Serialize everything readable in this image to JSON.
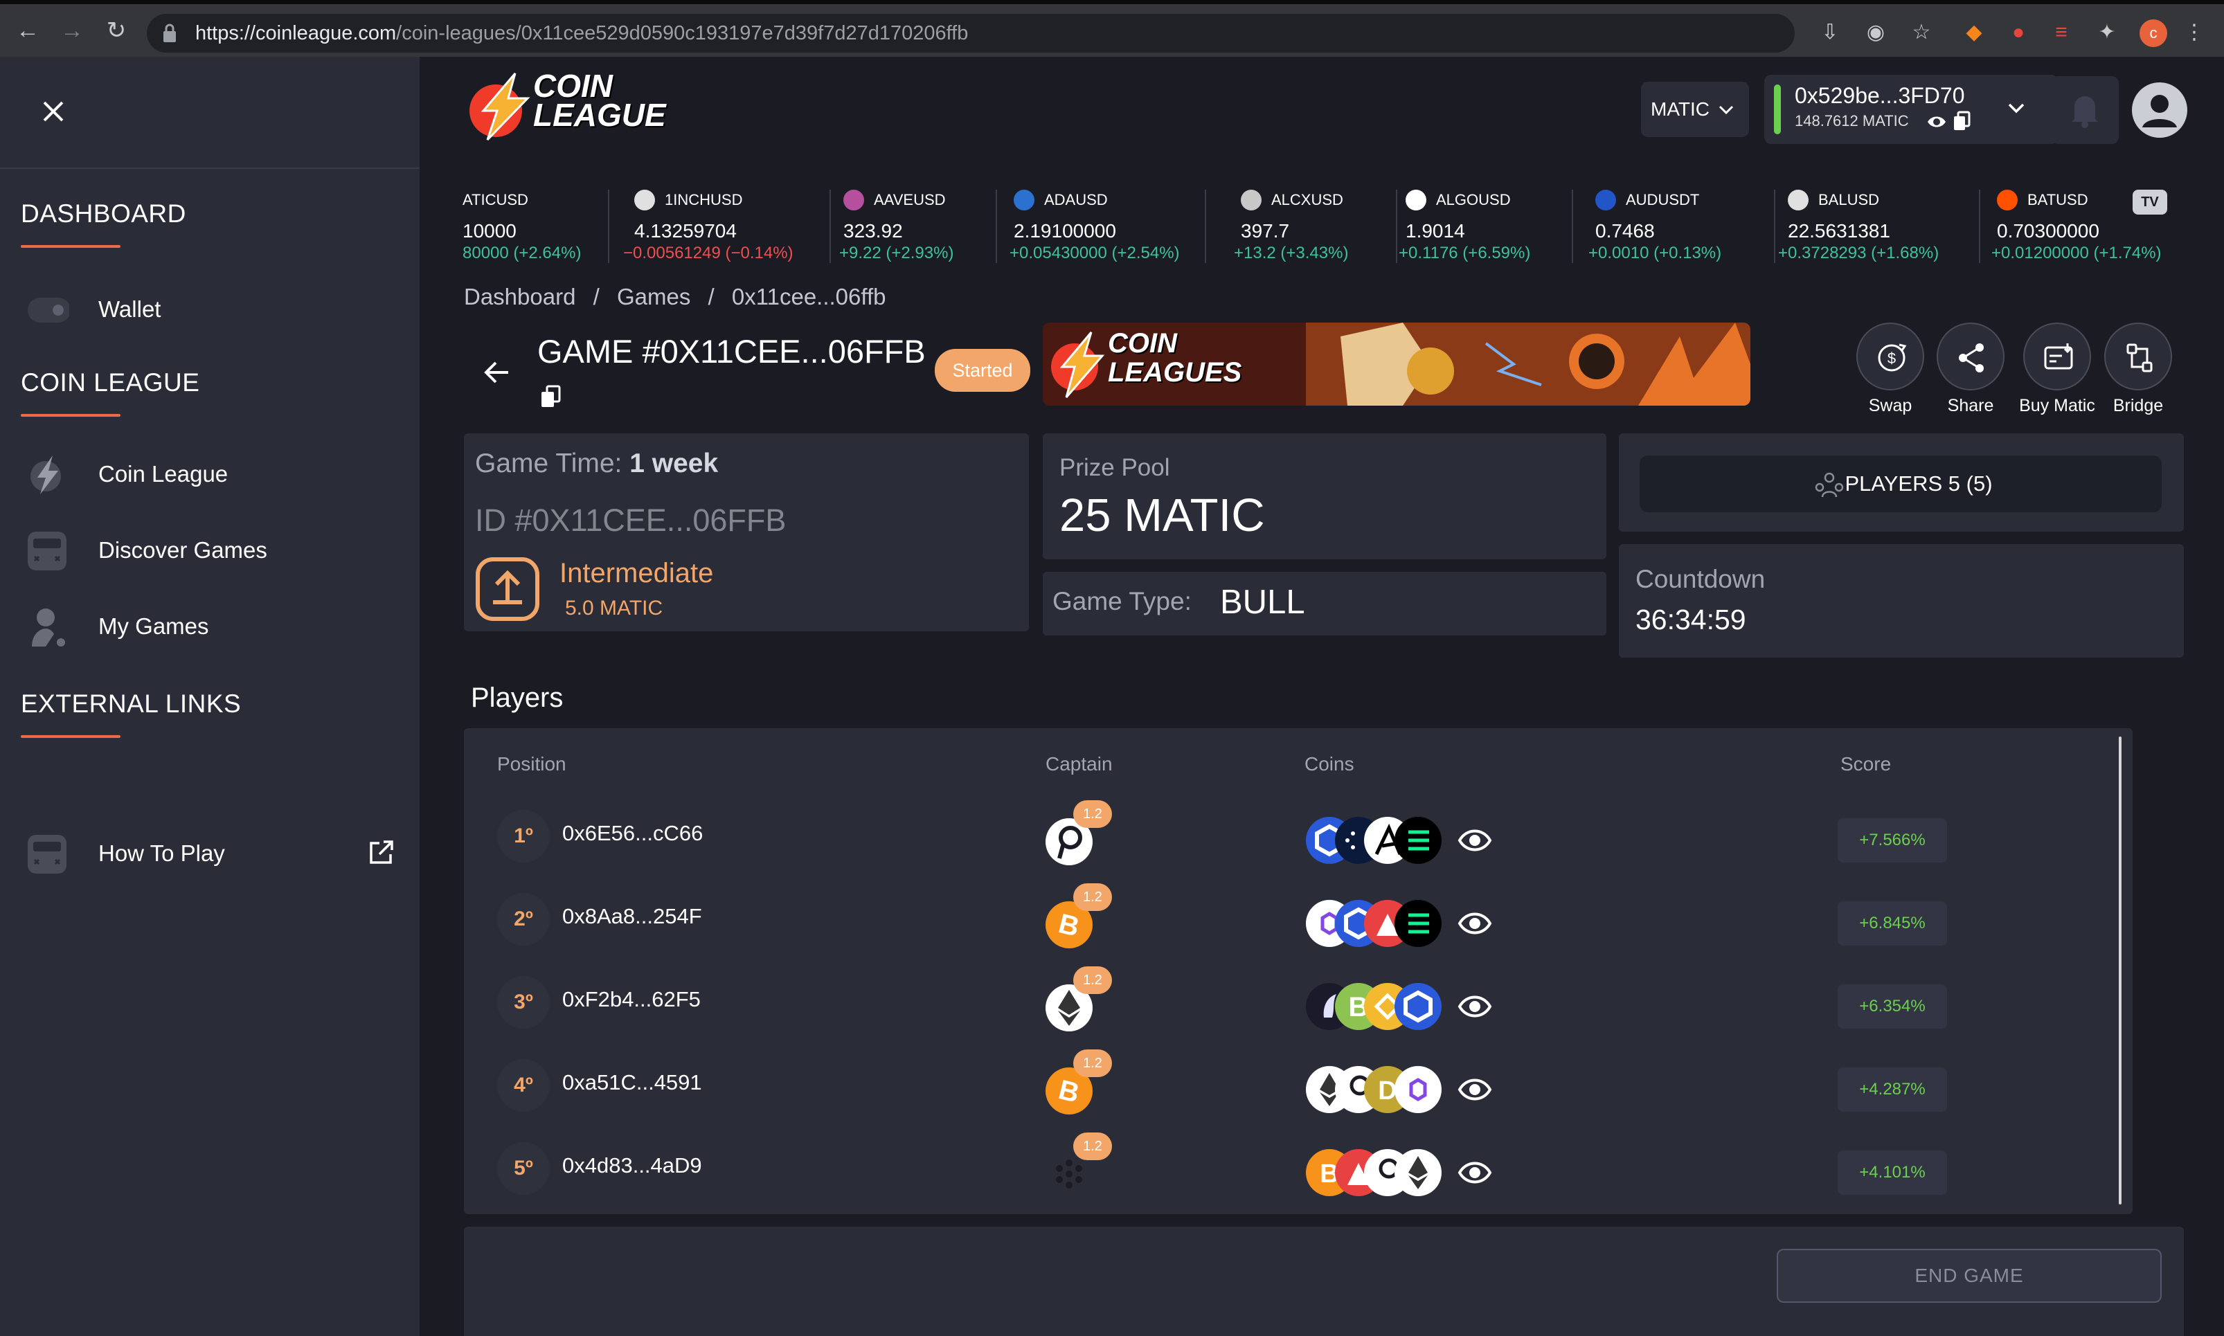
{
  "browser": {
    "url_domain": "https://coinleague.com",
    "url_path": "/coin-leagues/0x11cee529d0590c193197e7d39f7d27d170206ffb",
    "profile_initial": "c"
  },
  "sidebar": {
    "sections": [
      {
        "heading": "DASHBOARD",
        "items": [
          {
            "label": "Wallet",
            "icon": "toggle-icon"
          }
        ]
      },
      {
        "heading": "COIN LEAGUE",
        "items": [
          {
            "label": "Coin League",
            "icon": "coin-league-icon"
          },
          {
            "label": "Discover Games",
            "icon": "gamepad-icon"
          },
          {
            "label": "My Games",
            "icon": "user-icon"
          }
        ]
      },
      {
        "heading": "EXTERNAL LINKS",
        "items": [
          {
            "label": "How To Play",
            "icon": "gamepad-icon"
          }
        ]
      }
    ]
  },
  "header": {
    "logo_line1": "COIN",
    "logo_line2": "LEAGUE",
    "network": "MATIC",
    "wallet_address": "0x529be...3FD70",
    "wallet_balance": "148.7612 MATIC"
  },
  "ticker": [
    {
      "symbol": "ATICUSD",
      "price": "10000",
      "change": "80000 (+2.64%)",
      "dir": "up"
    },
    {
      "symbol": "1INCHUSD",
      "price": "4.13259704",
      "change": "−0.00561249 (−0.14%)",
      "dir": "down"
    },
    {
      "symbol": "AAVEUSD",
      "price": "323.92",
      "change": "+9.22 (+2.93%)",
      "dir": "up"
    },
    {
      "symbol": "ADAUSD",
      "price": "2.19100000",
      "change": "+0.05430000 (+2.54%)",
      "dir": "up"
    },
    {
      "symbol": "ALCXUSD",
      "price": "397.7",
      "change": "+13.2 (+3.43%)",
      "dir": "up"
    },
    {
      "symbol": "ALGOUSD",
      "price": "1.9014",
      "change": "+0.1176 (+6.59%)",
      "dir": "up"
    },
    {
      "symbol": "AUDUSDT",
      "price": "0.7468",
      "change": "+0.0010 (+0.13%)",
      "dir": "up"
    },
    {
      "symbol": "BALUSD",
      "price": "22.5631381",
      "change": "+0.3728293 (+1.68%)",
      "dir": "up"
    },
    {
      "symbol": "BATUSD",
      "price": "0.70300000",
      "change": "+0.01200000 (+1.74%)",
      "dir": "up"
    }
  ],
  "breadcrumb": [
    "Dashboard",
    "/",
    "Games",
    "/",
    "0x11cee...06ffb"
  ],
  "game": {
    "title": "GAME #0X11CEE...06FFB",
    "status": "Started",
    "banner_line1": "COIN",
    "banner_line2": "LEAGUES",
    "time_label": "Game Time:",
    "time_value": "1 week",
    "id": "ID #0X11CEE...06FFB",
    "level": "Intermediate",
    "level_amount": "5.0 MATIC",
    "prize_label": "Prize Pool",
    "prize_value": "25 MATIC",
    "type_label": "Game Type:",
    "type_value": "BULL",
    "players_label": "PLAYERS 5 (5)",
    "countdown_label": "Countdown",
    "countdown_value": "36:34:59"
  },
  "actions": [
    {
      "label": "Swap",
      "icon": "swap-icon"
    },
    {
      "label": "Share",
      "icon": "share-icon"
    },
    {
      "label": "Buy Matic",
      "icon": "buy-icon"
    },
    {
      "label": "Bridge",
      "icon": "bridge-icon"
    }
  ],
  "players": {
    "heading": "Players",
    "columns": [
      "Position",
      "Captain",
      "Coins",
      "Score"
    ],
    "rows": [
      {
        "position": "1º",
        "address": "0x6E56...cC66",
        "captain_multiplier": "1.2",
        "captain_coin": "polkadot",
        "coins": [
          "chainlink",
          "cardano",
          "algorand",
          "solana"
        ],
        "score": "+7.566%"
      },
      {
        "position": "2º",
        "address": "0x8Aa8...254F",
        "captain_multiplier": "1.2",
        "captain_coin": "bitcoin",
        "coins": [
          "polygon",
          "chainlink",
          "avalanche",
          "solana"
        ],
        "score": "+6.845%"
      },
      {
        "position": "3º",
        "address": "0xF2b4...62F5",
        "captain_multiplier": "1.2",
        "captain_coin": "ethereum",
        "coins": [
          "uniswap",
          "bitcoin-cash",
          "binance",
          "chainlink"
        ],
        "score": "+6.354%"
      },
      {
        "position": "4º",
        "address": "0xa51C...4591",
        "captain_multiplier": "1.2",
        "captain_coin": "bitcoin",
        "coins": [
          "ethereum",
          "polkadot",
          "dogecoin",
          "polygon"
        ],
        "score": "+4.287%"
      },
      {
        "position": "5º",
        "address": "0x4d83...4aD9",
        "captain_multiplier": "1.2",
        "captain_coin": "cardano",
        "coins": [
          "bitcoin",
          "avalanche",
          "polkadot",
          "ethereum"
        ],
        "score": "+4.101%"
      }
    ]
  },
  "footer": {
    "end_game_label": "END GAME"
  },
  "colors": {
    "accent": "#f3a66a",
    "brand_red": "#f06a4a",
    "score_green": "#6bd04e",
    "sidebar_bg": "#2a2c38",
    "page_bg": "#1a1b23"
  }
}
